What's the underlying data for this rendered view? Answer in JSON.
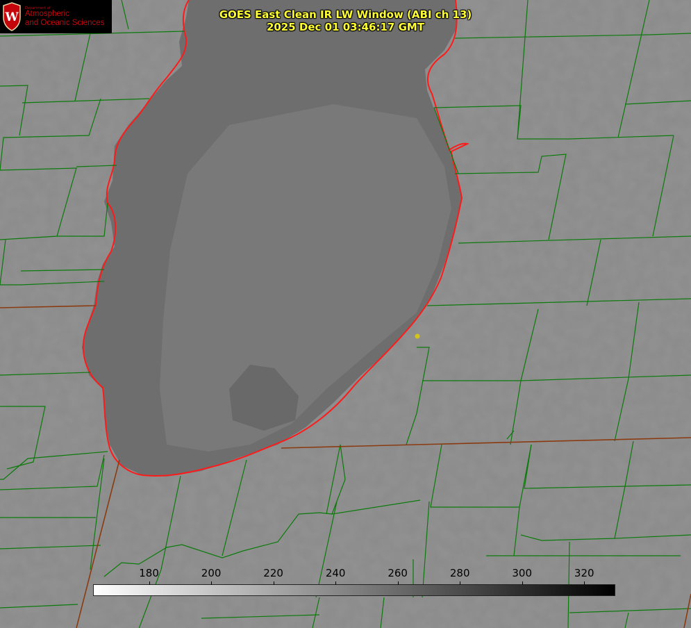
{
  "title": {
    "line1": "GOES East Clean IR LW Window (ABI ch 13)",
    "line2": "2025 Dec 01 03:46:17 GMT"
  },
  "logo": {
    "department": "Department of",
    "line1": "Atmospheric",
    "line2": "and Oceanic Sciences",
    "seal_letter": "W"
  },
  "colorbar": {
    "ticks": [
      "180",
      "200",
      "220",
      "240",
      "260",
      "280",
      "300",
      "320"
    ],
    "min": 162,
    "max": 330,
    "gradient_from": "#ffffff",
    "gradient_to": "#000000"
  },
  "colors": {
    "land": "#8a8a8a",
    "lake": "#6d6d6d",
    "county_lines": "#0b7a0b",
    "state_lines": "#8b3a10",
    "shoreline": "#ff1a1a",
    "title_text": "#ffff33",
    "marker": "#d4c41a"
  }
}
